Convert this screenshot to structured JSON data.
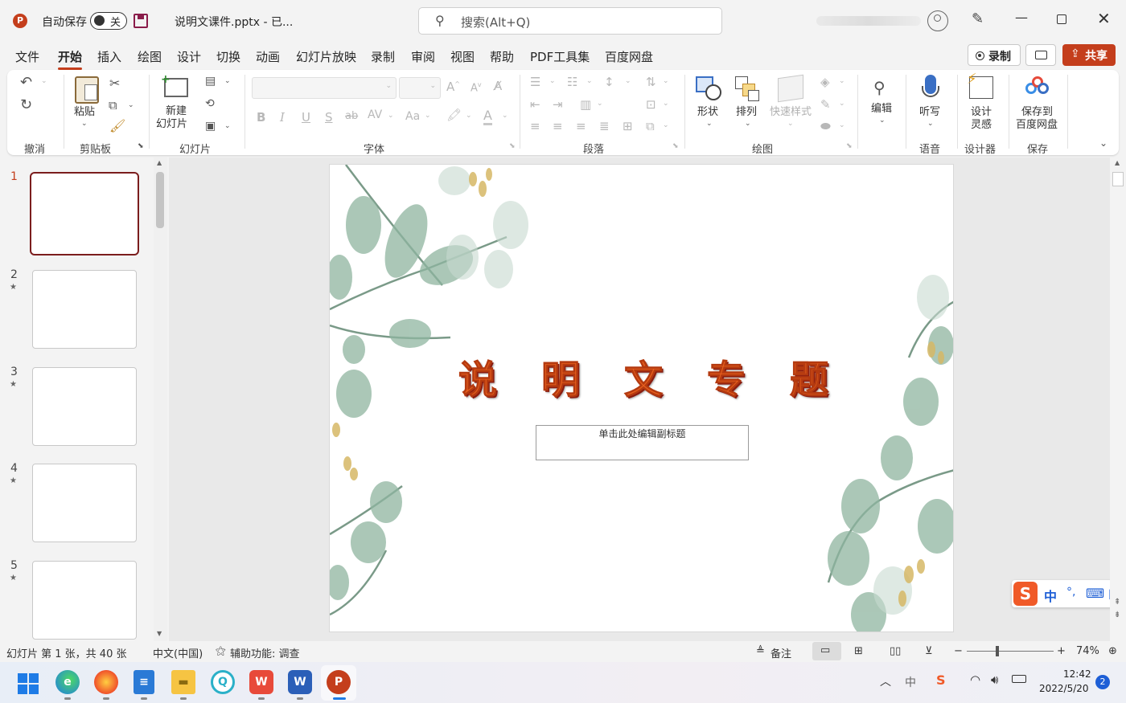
{
  "titlebar": {
    "autosave_label": "自动保存",
    "autosave_state": "关",
    "filename": "说明文课件.pptx  -  已...",
    "search_placeholder": "搜索(Alt+Q)"
  },
  "menu": [
    "文件",
    "开始",
    "插入",
    "绘图",
    "设计",
    "切换",
    "动画",
    "幻灯片放映",
    "录制",
    "审阅",
    "视图",
    "帮助",
    "PDF工具集",
    "百度网盘"
  ],
  "menu_active_index": 1,
  "actions": {
    "record": "录制",
    "share": "共享"
  },
  "ribbon": {
    "groups": {
      "undo": "撤消",
      "clipboard": "剪贴板",
      "slides": "幻灯片",
      "font": "字体",
      "paragraph": "段落",
      "drawing": "绘图",
      "voice": "语音",
      "designer": "设计器",
      "save": "保存"
    },
    "paste": "粘贴",
    "new_slide_1": "新建",
    "new_slide_2": "幻灯片",
    "shapes": "形状",
    "arrange": "排列",
    "quick_styles": "快速样式",
    "editing": "编辑",
    "dictate": "听写",
    "designer_1": "设计",
    "designer_2": "灵感",
    "save_baidu_1": "保存到",
    "save_baidu_2": "百度网盘",
    "bold": "B",
    "italic": "I",
    "underline": "U",
    "strike": "S",
    "strike2": "ab",
    "spacing": "AV",
    "case": "Aa",
    "fontcolor": "A"
  },
  "thumbnails": [
    {
      "num": "1",
      "star": ""
    },
    {
      "num": "2",
      "star": "★"
    },
    {
      "num": "3",
      "star": "★"
    },
    {
      "num": "4",
      "star": "★"
    },
    {
      "num": "5",
      "star": "★"
    }
  ],
  "slide": {
    "title_chars": [
      "说",
      "明",
      "文",
      "专",
      "题"
    ],
    "subtitle_placeholder": "单击此处编辑副标题"
  },
  "ime": {
    "lang": "中",
    "punct": "°,"
  },
  "status": {
    "slide_info": "幻灯片 第 1 张，共 40 张",
    "language": "中文(中国)",
    "accessibility": "辅助功能: 调查",
    "notes": "备注",
    "zoom": "74%"
  },
  "taskbar": {
    "time": "12:42",
    "date": "2022/5/20",
    "notification_count": "2",
    "ime_indicator": "中"
  },
  "colors": {
    "accent": "#c43e1c",
    "leaf": "#8fb5a0",
    "title_text": "#e8601e"
  }
}
